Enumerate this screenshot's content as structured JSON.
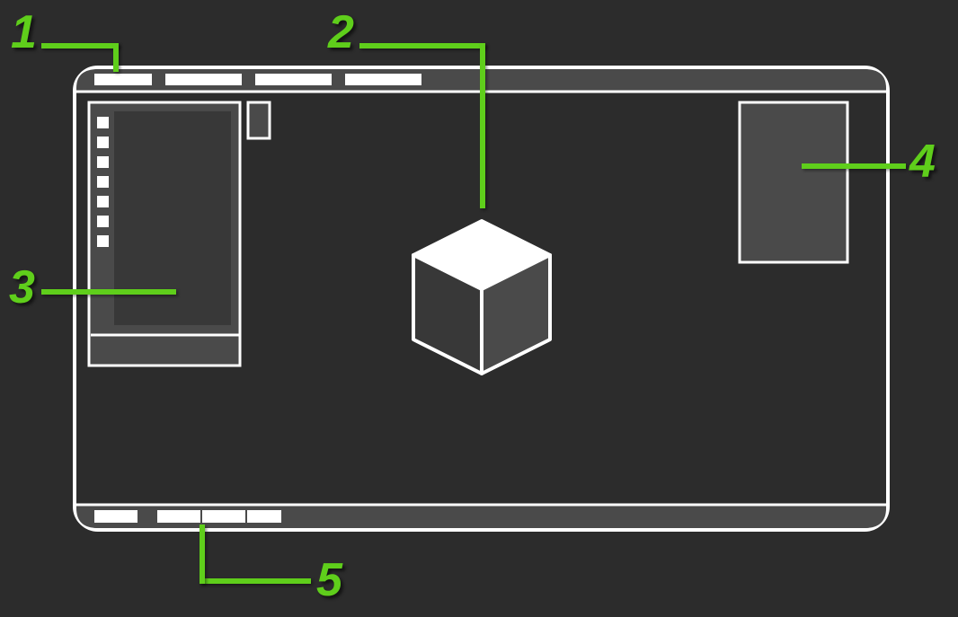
{
  "callouts": {
    "n1": "1",
    "n2": "2",
    "n3": "3",
    "n4": "4",
    "n5": "5"
  },
  "colors": {
    "bg": "#2c2c2c",
    "panel": "#4a4a4a",
    "stroke": "#ffffff",
    "shade": "#383838",
    "accent": "#5fce1b"
  },
  "diagram": {
    "regions": [
      "menu-bar",
      "viewport",
      "tool-panel",
      "side-panel",
      "status-bar"
    ]
  }
}
